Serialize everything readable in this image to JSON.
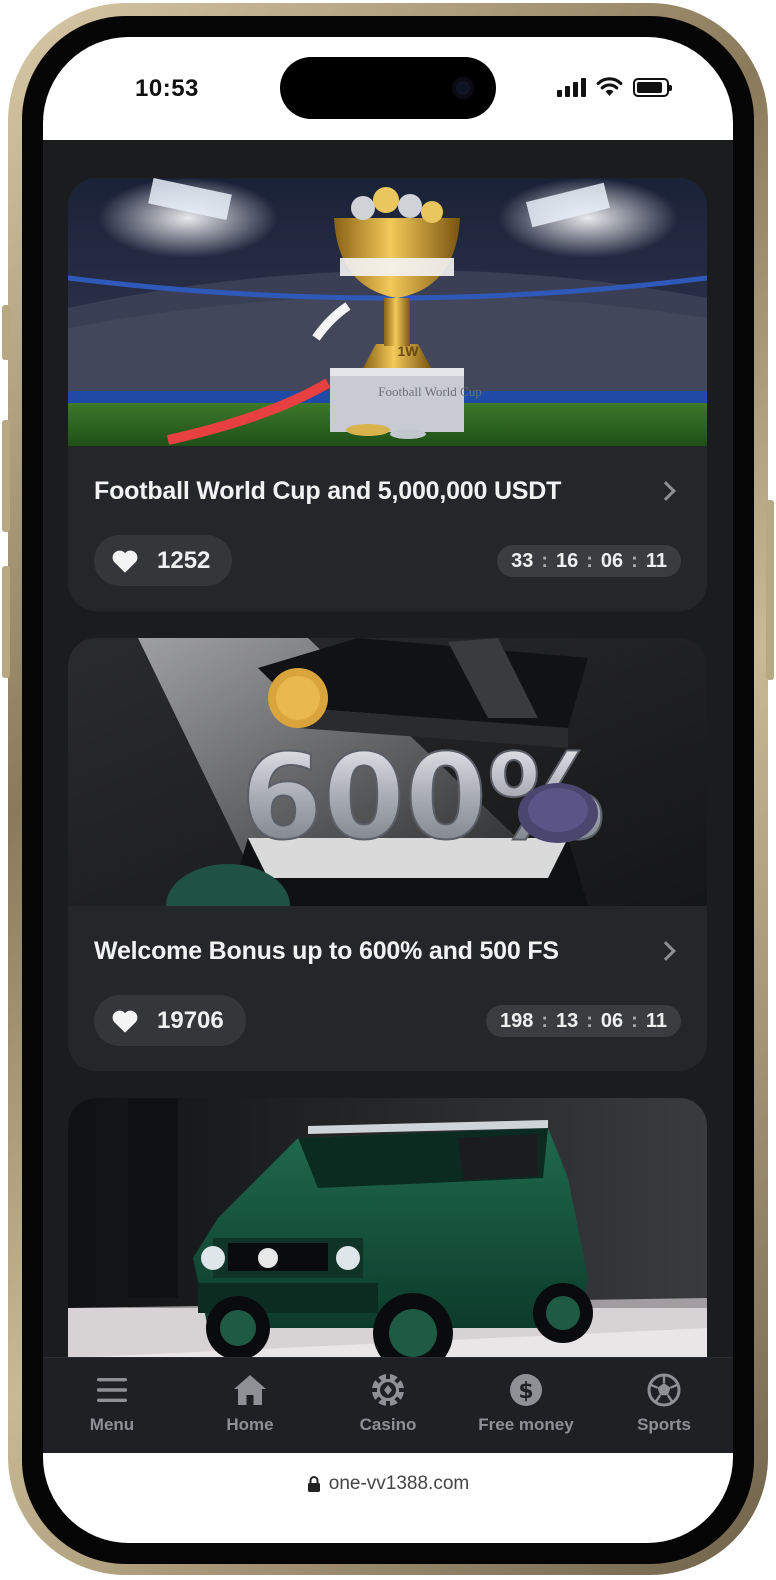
{
  "status_bar": {
    "time": "10:53",
    "icons": [
      "cellular-signal-icon",
      "wifi-icon",
      "battery-icon"
    ],
    "battery_level": 0.9
  },
  "promotions": [
    {
      "title": "Football World Cup and 5,000,000 USDT",
      "likes": "1252",
      "timer": [
        "33",
        "16",
        "06",
        "11"
      ],
      "banner": {
        "image": "trophy-stadium-banner",
        "trophy_text": "Football World Cup",
        "logo": "1W"
      }
    },
    {
      "title": "Welcome Bonus up to 600% and 500 FS",
      "likes": "19706",
      "timer": [
        "198",
        "13",
        "06",
        "11"
      ],
      "banner": {
        "image": "gift-box-600-banner",
        "big_text": "600%"
      }
    },
    {
      "banner": {
        "image": "green-suv-banner"
      }
    }
  ],
  "tab_bar": {
    "items": [
      {
        "label": "Menu",
        "icon": "hamburger-menu-icon"
      },
      {
        "label": "Home",
        "icon": "home-icon"
      },
      {
        "label": "Casino",
        "icon": "casino-chip-icon"
      },
      {
        "label": "Free money",
        "icon": "dollar-coin-icon"
      },
      {
        "label": "Sports",
        "icon": "soccer-ball-icon"
      }
    ]
  },
  "browser": {
    "url": "one-vv1388.com",
    "icon": "lock-icon"
  },
  "colors": {
    "background": "#1b1c1e",
    "card": "#252629",
    "pill": "#34363a",
    "text": "#f2f2f2",
    "tab_text": "#8e9095",
    "frame_gold": "#c9b994"
  }
}
